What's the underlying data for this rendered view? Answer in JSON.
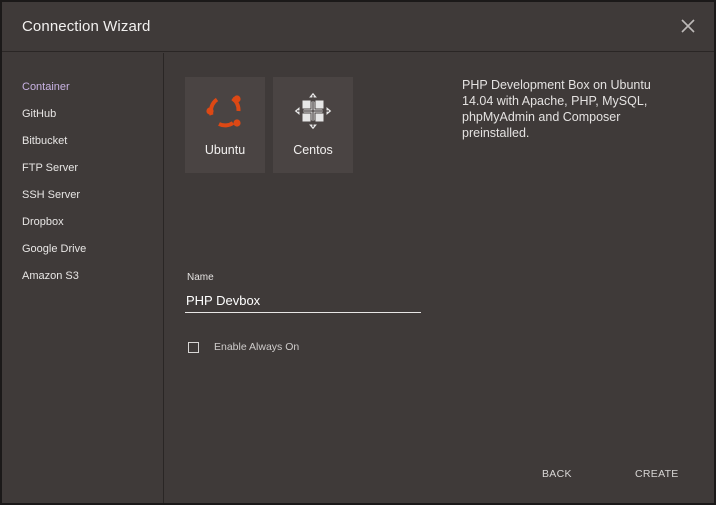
{
  "window": {
    "title": "Connection Wizard"
  },
  "sidebar": {
    "items": [
      {
        "label": "Container",
        "active": true
      },
      {
        "label": "GitHub"
      },
      {
        "label": "Bitbucket"
      },
      {
        "label": "FTP Server"
      },
      {
        "label": "SSH Server"
      },
      {
        "label": "Dropbox"
      },
      {
        "label": "Google Drive"
      },
      {
        "label": "Amazon S3"
      }
    ]
  },
  "images": [
    {
      "label": "Ubuntu",
      "icon": "ubuntu-logo-icon",
      "color": "#dd4814"
    },
    {
      "label": "Centos",
      "icon": "centos-logo-icon",
      "color": "#e6e6e6"
    }
  ],
  "description": "PHP Development Box on Ubuntu 14.04 with Apache, PHP, MySQL, phpMyAdmin and Composer preinstalled.",
  "form": {
    "name_label": "Name",
    "name_value": "PHP Devbox",
    "always_on_label": "Enable Always On",
    "always_on_checked": false
  },
  "buttons": {
    "back": "BACK",
    "create": "CREATE"
  },
  "colors": {
    "background": "#3f3a39",
    "tile": "#4a4443",
    "accent": "#c8b2e3"
  }
}
